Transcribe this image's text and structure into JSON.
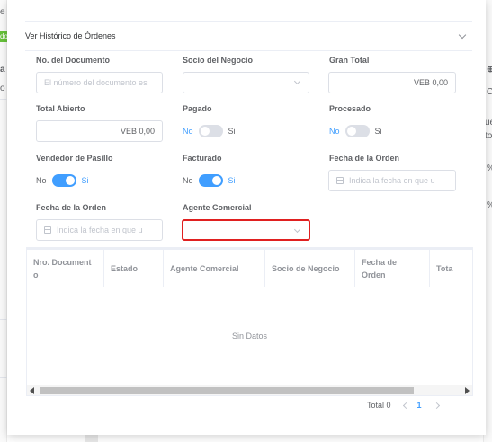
{
  "background": {
    "left_snippets": [
      "e",
      "do",
      "a",
      "o"
    ],
    "right_snippets": [
      "C",
      "ue",
      "to",
      "%",
      "%"
    ]
  },
  "collapse": {
    "title": "Ver Histórico de Órdenes"
  },
  "form": {
    "document_no": {
      "label": "No. del Documento",
      "placeholder": "El número del documento es"
    },
    "business_partner": {
      "label": "Socio del Negocio",
      "value": ""
    },
    "grand_total": {
      "label": "Gran Total",
      "value": "VEB 0,00"
    },
    "open_total": {
      "label": "Total Abierto",
      "value": "VEB 0,00"
    },
    "paid": {
      "label": "Pagado",
      "off_text": "No",
      "on_text": "Si",
      "state": "off"
    },
    "processed": {
      "label": "Procesado",
      "off_text": "No",
      "on_text": "Si",
      "state": "off"
    },
    "salesperson": {
      "label": "Vendedor de Pasillo",
      "off_text": "No",
      "on_text": "Si",
      "state": "on"
    },
    "invoiced": {
      "label": "Facturado",
      "off_text": "No",
      "on_text": "Si",
      "state": "on"
    },
    "order_date_1": {
      "label": "Fecha de la Orden",
      "placeholder": "Indica la fecha en que u"
    },
    "order_date_2": {
      "label": "Fecha de la Orden",
      "placeholder": "Indica la fecha en que u"
    },
    "sales_agent": {
      "label": "Agente Comercial",
      "value": ""
    }
  },
  "table": {
    "columns": [
      "Nro. Document o",
      "Estado",
      "Agente Comercial",
      "Socio de Negocio",
      "Fecha de Orden",
      "Tota"
    ],
    "empty_text": "Sin Datos"
  },
  "pagination": {
    "total_text": "Total 0",
    "current_page": "1"
  },
  "colors": {
    "accent": "#409eff",
    "highlight_border": "#e02020"
  }
}
